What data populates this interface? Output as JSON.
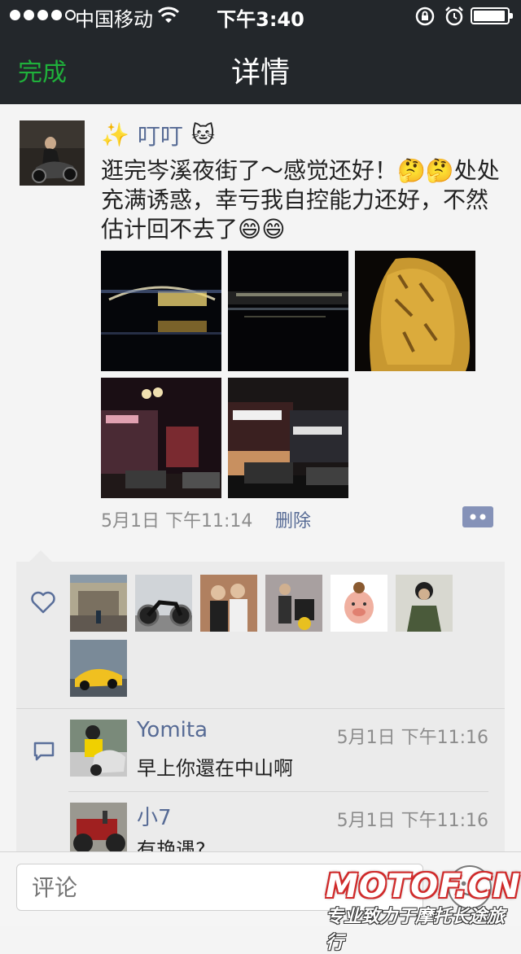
{
  "status_bar": {
    "carrier": "中国移动",
    "time": "下午3:40",
    "signal_bars": 4,
    "battery_level": 0.95
  },
  "nav": {
    "done_label": "完成",
    "title": "详情"
  },
  "post": {
    "username": "叮叮",
    "username_prefix_emoji": "✨",
    "username_suffix_emoji": "🐱",
    "text": "逛完岑溪夜街了～感觉还好！🤔🤔处处充满诱惑，幸亏我自控能力还好，不然估计回不去了😄😄",
    "timestamp": "5月1日 下午11:14",
    "delete_label": "删除",
    "photos": [
      "night-bridge-reflection",
      "night-riverfront",
      "engraved-stone-monument",
      "night-street-shops",
      "night-shopfront-cars"
    ]
  },
  "likes": {
    "icon": "heart-icon",
    "users": [
      "liker-1",
      "liker-2",
      "liker-3",
      "liker-4",
      "liker-5",
      "liker-6",
      "liker-7"
    ]
  },
  "comments": [
    {
      "name": "Yomita",
      "time": "5月1日 下午11:16",
      "text": "早上你還在中山啊"
    },
    {
      "name": "小7",
      "time": "5月1日 下午11:16",
      "text": "有艳遇?"
    }
  ],
  "input": {
    "placeholder": "评论"
  },
  "watermark": {
    "logo": "MOTOF.CN",
    "tagline": "专业致力于摩托长途旅行"
  },
  "colors": {
    "nav_bg": "#23272b",
    "done_green": "#1fb13b",
    "link_blue": "#576b95",
    "panel_bg": "#ebebeb"
  }
}
